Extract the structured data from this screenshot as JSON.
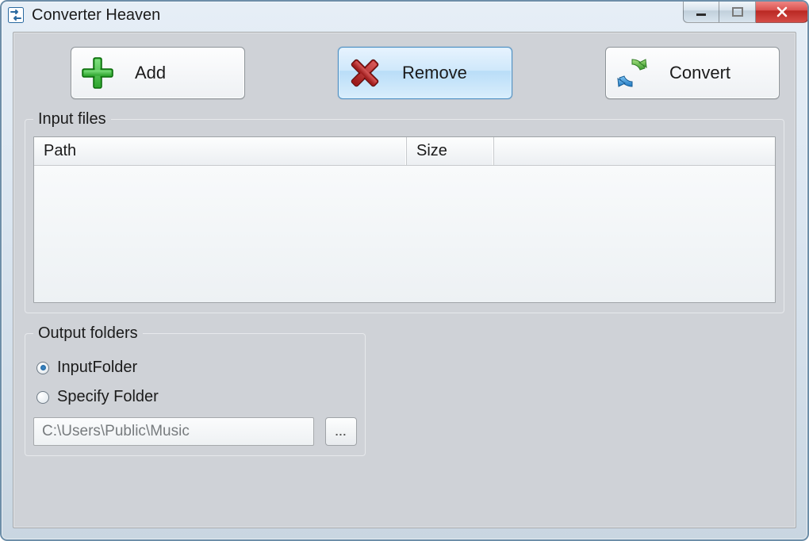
{
  "window": {
    "title": "Converter Heaven"
  },
  "toolbar": {
    "add_label": "Add",
    "remove_label": "Remove",
    "convert_label": "Convert"
  },
  "input_files": {
    "legend": "Input files",
    "columns": {
      "path": "Path",
      "size": "Size"
    },
    "rows": []
  },
  "output_folders": {
    "legend": "Output folders",
    "option_input_folder": "InputFolder",
    "option_specify_folder": "Specify Folder",
    "selected": "InputFolder",
    "path_value": "C:\\Users\\Public\\Music",
    "browse_label": "..."
  }
}
